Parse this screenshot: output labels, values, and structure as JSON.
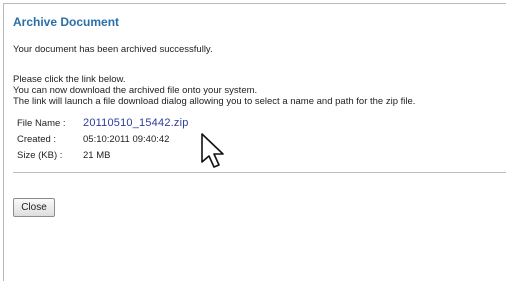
{
  "dialog": {
    "title": "Archive Document",
    "message": "Your document has been archived successfully.",
    "instructions": [
      "Please click the link below.",
      "You can now download the archived file onto your system.",
      "The link will launch a file download dialog allowing you to select a name and path for the zip file."
    ]
  },
  "file": {
    "name_label": "File Name :",
    "name_value": "20110510_15442.zip",
    "created_label": "Created :",
    "created_value": "05:10:2011 09:40:42",
    "size_label": "Size (KB) :",
    "size_value": "21 MB"
  },
  "buttons": {
    "close_label": "Close"
  },
  "icons": {
    "cursor": "mouse-pointer-icon"
  }
}
